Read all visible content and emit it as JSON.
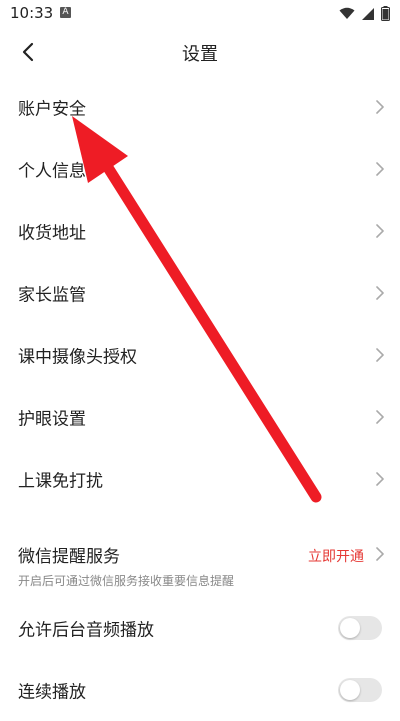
{
  "status_bar": {
    "time": "10:33",
    "notification_badge": "A"
  },
  "header": {
    "title": "设置"
  },
  "settings": {
    "items": [
      {
        "label": "账户安全"
      },
      {
        "label": "个人信息"
      },
      {
        "label": "收货地址"
      },
      {
        "label": "家长监管"
      },
      {
        "label": "课中摄像头授权"
      },
      {
        "label": "护眼设置"
      },
      {
        "label": "上课免打扰"
      }
    ],
    "wechat": {
      "label": "微信提醒服务",
      "sub": "开启后可通过微信服务接收重要信息提醒",
      "action": "立即开通"
    },
    "toggles": [
      {
        "label": "允许后台音频播放",
        "on": false
      },
      {
        "label": "连续播放",
        "on": false
      }
    ]
  },
  "colors": {
    "accent_red": "#e53935",
    "annotation_arrow": "#ee1c25",
    "toggle_off": "#e6e6e6"
  },
  "icons": {
    "back": "chevron-left-icon",
    "row": "chevron-right-icon",
    "wifi": "wifi-icon",
    "signal": "signal-icon",
    "battery": "battery-icon"
  }
}
